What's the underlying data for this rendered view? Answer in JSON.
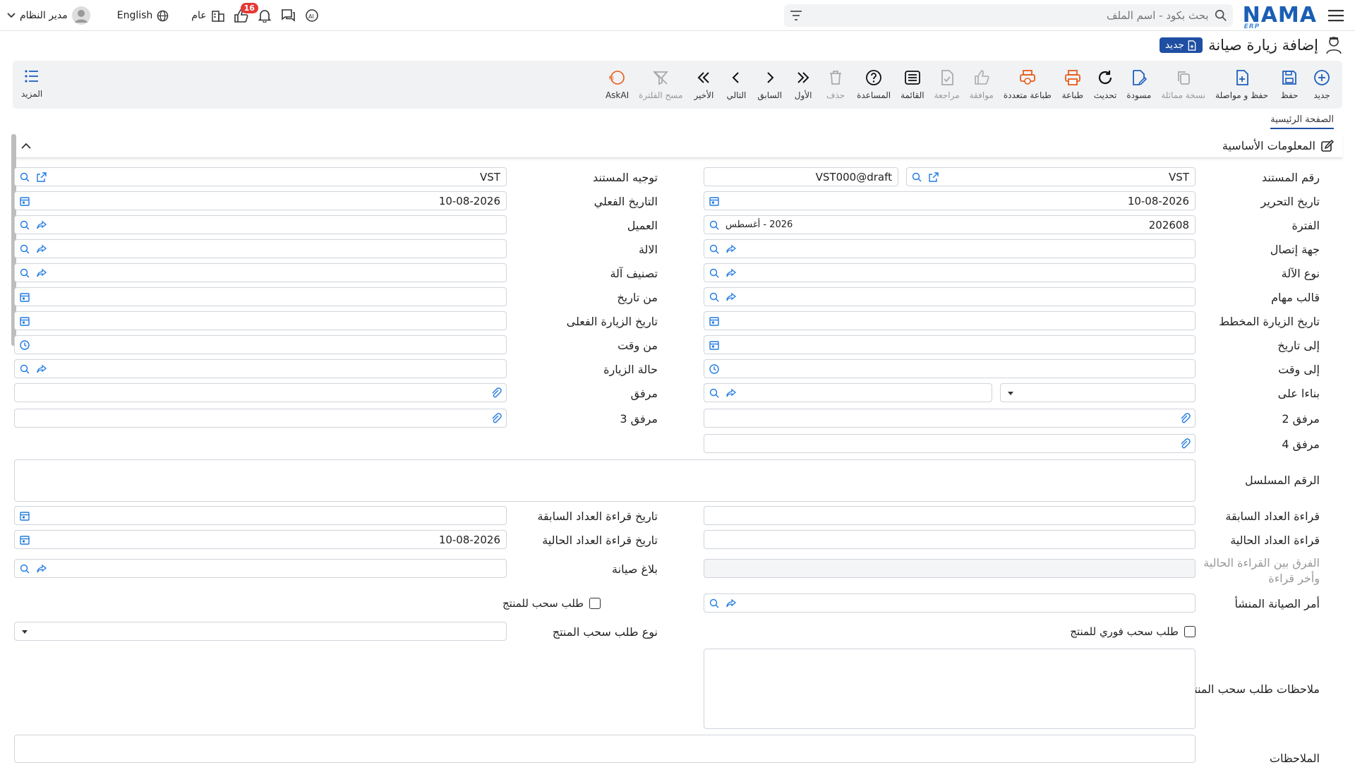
{
  "header": {
    "search_placeholder": "بحث بكود - اسم الملف",
    "user": "مدير النظام",
    "language": "English",
    "scope": "عام",
    "notifications_count": "16",
    "logo": "NAMA",
    "logo_sub": "ERP"
  },
  "page": {
    "title": "إضافة زيارة صيانة",
    "status": "جديد"
  },
  "toolbar": {
    "new": "جديد",
    "save": "حفظ",
    "save_continue": "حفظ و مواصلة",
    "duplicate": "نسخة مماثلة",
    "draft": "مسودة",
    "refresh": "تحديث",
    "print": "طباعة",
    "multi_print": "طباعة متعددة",
    "approve": "موافقة",
    "review": "مراجعة",
    "list": "القائمة",
    "help": "المساعدة",
    "delete": "حذف",
    "first": "الأول",
    "previous": "السابق",
    "next": "التالي",
    "last": "الأخير",
    "clear_filter": "مسح الفلترة",
    "askai": "AskAI",
    "more": "المزيد"
  },
  "tabs": {
    "main": "الصفحة الرئيسية"
  },
  "section": {
    "title": "المعلومات الأساسية"
  },
  "form": {
    "doc_no_label": "رقم المستند",
    "doc_no_prefix": "VST",
    "doc_no_value": "VST000@draft",
    "doc_dir_label": "توجيه المستند",
    "doc_dir_value": "VST",
    "edit_date_label": "تاريخ التحرير",
    "edit_date_value": "10-08-2026",
    "actual_date_label": "التاريخ الفعلي",
    "actual_date_value": "10-08-2026",
    "period_label": "الفترة",
    "period_value": "202608",
    "period_desc": "2026 - أغسطس",
    "customer_label": "العميل",
    "contact_label": "جهة إتصال",
    "machine_label": "الالة",
    "machine_type_label": "نوع الآلة",
    "machine_class_label": "تصنيف آلة",
    "task_template_label": "قالب مهام",
    "from_date_label": "من تاريخ",
    "planned_visit_label": "تاريخ الزيارة المخطط",
    "actual_visit_label": "تاريخ الزيارة الفعلى",
    "to_date_label": "إلى تاريخ",
    "from_time_label": "من وقت",
    "to_time_label": "إلى وقت",
    "visit_status_label": "حالة الزيارة",
    "based_on_label": "بناءا على",
    "attach_label": "مرفق",
    "attach2_label": "مرفق 2",
    "attach3_label": "مرفق 3",
    "attach4_label": "مرفق 4",
    "serial_label": "الرقم المسلسل",
    "prev_reading_label": "قراءة العداد السابقة",
    "prev_reading_date_label": "تاريخ قراءة العداد السابقة",
    "curr_reading_label": "قراءة العداد الحالية",
    "curr_reading_date_label": "تاريخ قراءة العداد الحالية",
    "curr_reading_date_value": "10-08-2026",
    "diff_label": "الفرق بين القراءة الحالية وأخر قراءة",
    "maint_report_label": "بلاغ صيانة",
    "maint_order_label": "أمر الصيانة المنشأ",
    "withdraw_request_label": "طلب سحب للمنتج",
    "withdraw_type_label": "نوع طلب سحب المنتج",
    "instant_withdraw_label": "طلب سحب فوري للمنتج",
    "withdraw_notes_label": "ملاحظات طلب سحب المنتج",
    "notes_label": "الملاحظات"
  }
}
